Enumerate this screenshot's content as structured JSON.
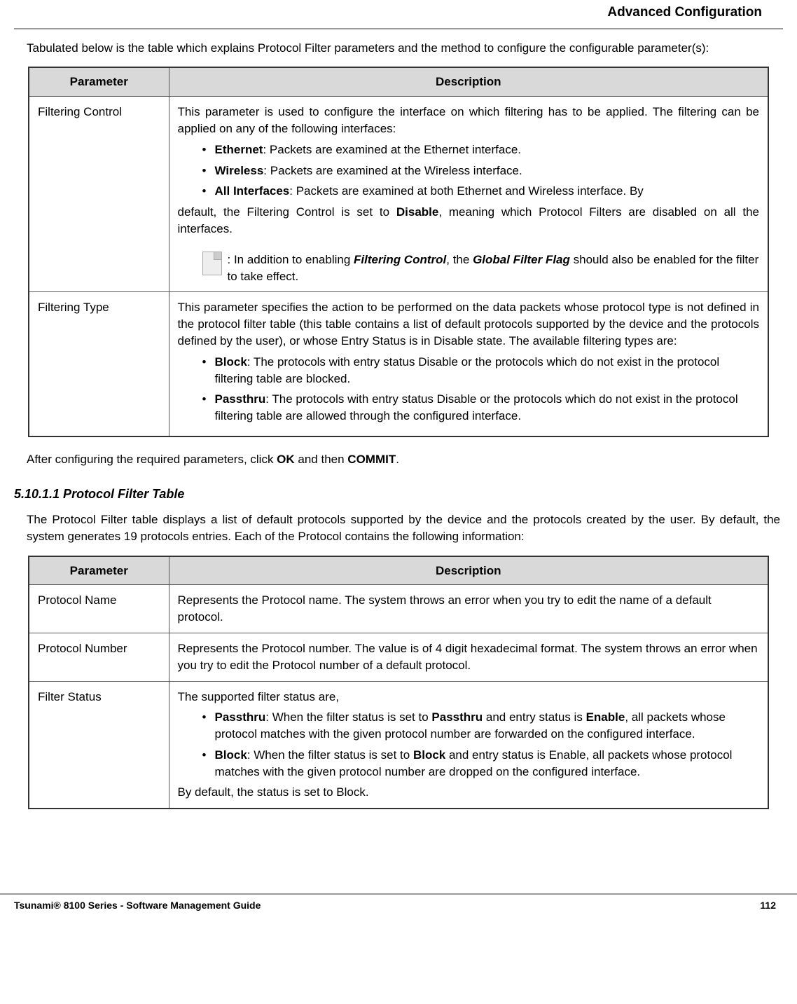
{
  "header": {
    "title": "Advanced Configuration"
  },
  "intro": "Tabulated below is the table which explains Protocol Filter parameters and the method to configure the configurable parameter(s):",
  "table1": {
    "headers": [
      "Parameter",
      "Description"
    ],
    "rows": [
      {
        "param": "Filtering Control",
        "desc_intro": "This parameter is used to configure the interface on which filtering has to be applied. The filtering can be applied on any of the following interfaces:",
        "bullets": [
          {
            "bold": "Ethernet",
            "text": ": Packets are examined at the Ethernet interface."
          },
          {
            "bold": "Wireless",
            "text": ": Packets are examined at the Wireless interface."
          },
          {
            "bold": "All Interfaces",
            "text": ": Packets are examined at both Ethernet and Wireless interface. By"
          }
        ],
        "after_bullets": "default, the Filtering Control is set to ",
        "after_bold": "Disable",
        "after_tail": ", meaning which Protocol Filters are disabled on all the interfaces.",
        "note_pre": ": In addition to enabling ",
        "note_b1": "Filtering Control",
        "note_mid": ", the ",
        "note_b2": "Global Filter Flag",
        "note_post": " should also be enabled for the filter to take effect."
      },
      {
        "param": "Filtering Type",
        "desc_intro": "This parameter specifies the action to be performed on the data packets whose protocol type is not defined in the protocol filter table (this table contains a list of default protocols supported by the device and the protocols defined by the user), or whose Entry Status is in Disable state. The available filtering types are:",
        "bullets": [
          {
            "bold": "Block",
            "text": ": The protocols with entry status Disable or the protocols which do not exist in the protocol filtering table are blocked."
          },
          {
            "bold": "Passthru",
            "text": ": The protocols with entry status Disable or the protocols which do not exist in the protocol filtering table are allowed through the configured interface."
          }
        ]
      }
    ]
  },
  "after_table1_pre": "After configuring the required parameters, click ",
  "after_table1_b1": "OK",
  "after_table1_mid": " and then ",
  "after_table1_b2": "COMMIT",
  "after_table1_post": ".",
  "section_heading": "5.10.1.1 Protocol Filter Table",
  "section_intro": "The Protocol Filter table displays a list of default protocols supported by the device and the protocols created by the user. By default, the system generates 19 protocols entries. Each of the Protocol contains the following information:",
  "table2": {
    "headers": [
      "Parameter",
      "Description"
    ],
    "rows": [
      {
        "param": "Protocol Name",
        "desc": "Represents the Protocol name. The system throws an error when you try to edit the name of a default protocol."
      },
      {
        "param": "Protocol Number",
        "desc": "Represents the Protocol number. The value is of 4 digit hexadecimal format. The system throws an error when you try to edit the Protocol number of a default protocol."
      },
      {
        "param": "Filter Status",
        "desc_intro": "The supported filter status are,",
        "bullets": [
          {
            "bold": "Passthru",
            "pre": ": When the filter status is set to ",
            "b2": "Passthru",
            "mid": " and entry status is ",
            "b3": "Enable",
            "tail": ", all packets whose protocol matches with the given protocol number are forwarded on the configured interface."
          },
          {
            "bold": "Block",
            "pre": ": When the filter status is set to ",
            "b2": "Block",
            "mid": " and entry status is Enable, all packets whose protocol matches with the given protocol number are dropped on the configured interface.",
            "tail": ""
          }
        ],
        "desc_after": "By default, the status is set to Block."
      }
    ]
  },
  "footer": {
    "left": "Tsunami® 8100 Series - Software Management Guide",
    "right": "112"
  }
}
